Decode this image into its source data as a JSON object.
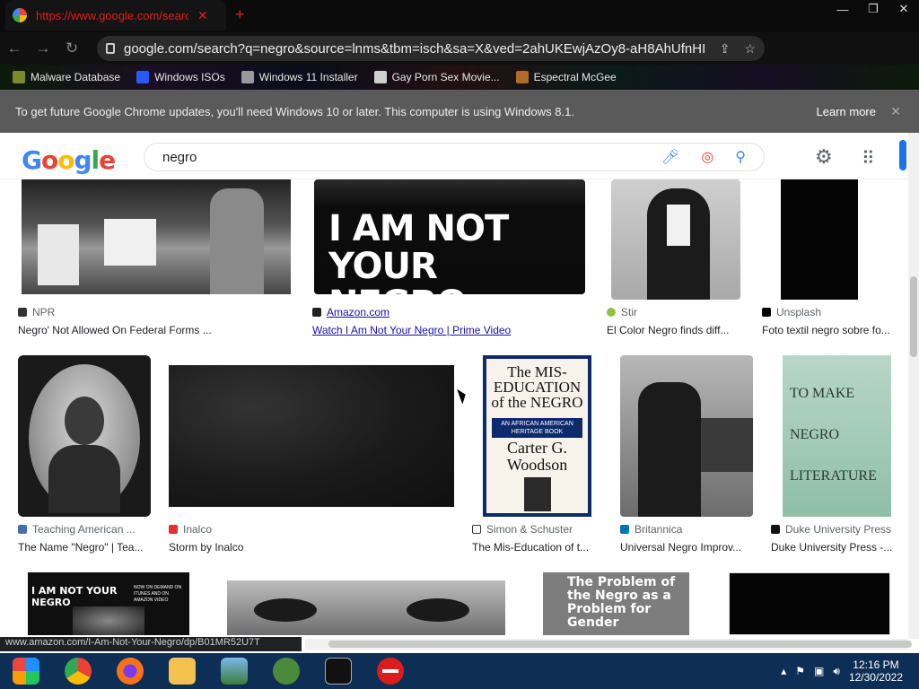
{
  "browser": {
    "tab_title": "https://www.google.com/search?q",
    "tab_small_text": "©ultrasummer.tumblr.com",
    "url": "google.com/search?q=negro&source=lnms&tbm=isch&sa=X&ved=2ahUKEwjAzOy8-aH8AhUfnHIE...",
    "bookmarks": [
      {
        "label": "Malware Database",
        "color": "#7a8a2a"
      },
      {
        "label": "Windows ISOs",
        "color": "#2a58ff"
      },
      {
        "label": "Windows 11 Installer",
        "color": "#9a9a9a"
      },
      {
        "label": "Gay Porn Sex Movie...",
        "color": "#d0d0d0"
      },
      {
        "label": "Espectral McGee",
        "color": "#b06a2a"
      }
    ],
    "info_message": "To get future Google Chrome updates, you'll need Windows 10 or later. This computer is using Windows 8.1.",
    "info_learn_more": "Learn more"
  },
  "google": {
    "logo": "Google",
    "query": "negro"
  },
  "results": [
    {
      "source": "NPR",
      "caption": "Negro' Not Allowed On Federal Forms ..."
    },
    {
      "source": "Amazon.com",
      "caption": "Watch I Am Not Your Negro | Prime Video",
      "img_text": "I AM NOT YOUR NEGRO"
    },
    {
      "source": "Stir",
      "caption": "El Color Negro finds diff..."
    },
    {
      "source": "Unsplash",
      "caption": "Foto textil negro sobre fo..."
    },
    {
      "source": "Teaching American ...",
      "caption": "The Name \"Negro\" | Tea..."
    },
    {
      "source": "Inalco",
      "caption": "Storm by Inalco"
    },
    {
      "source": "Simon & Schuster",
      "caption": "The Mis-Education of t...",
      "book_title": "The MIS-EDUCATION of the NEGRO",
      "book_band": "AN AFRICAN AMERICAN HERITAGE BOOK",
      "book_author": "Carter G. Woodson"
    },
    {
      "source": "Britannica",
      "caption": "Universal Negro Improv..."
    },
    {
      "source": "Duke University Press",
      "caption": "Duke University Press -...",
      "book_title": "TO MAKE NEGRO LITERATURE"
    },
    {
      "img_text": "I AM NOT YOUR NEGRO",
      "img_sub": "NOW ON DEMAND ON ITUNES AND ON AMAZON VIDEO"
    },
    {},
    {
      "img_text": "The Problem of the Negro as a Problem for Gender"
    },
    {}
  ],
  "status_url": "www.amazon.com/I-Am-Not-Your-Negro/dp/B01MR52U7T",
  "taskbar": {
    "time": "12:16 PM",
    "date": "12/30/2022"
  }
}
